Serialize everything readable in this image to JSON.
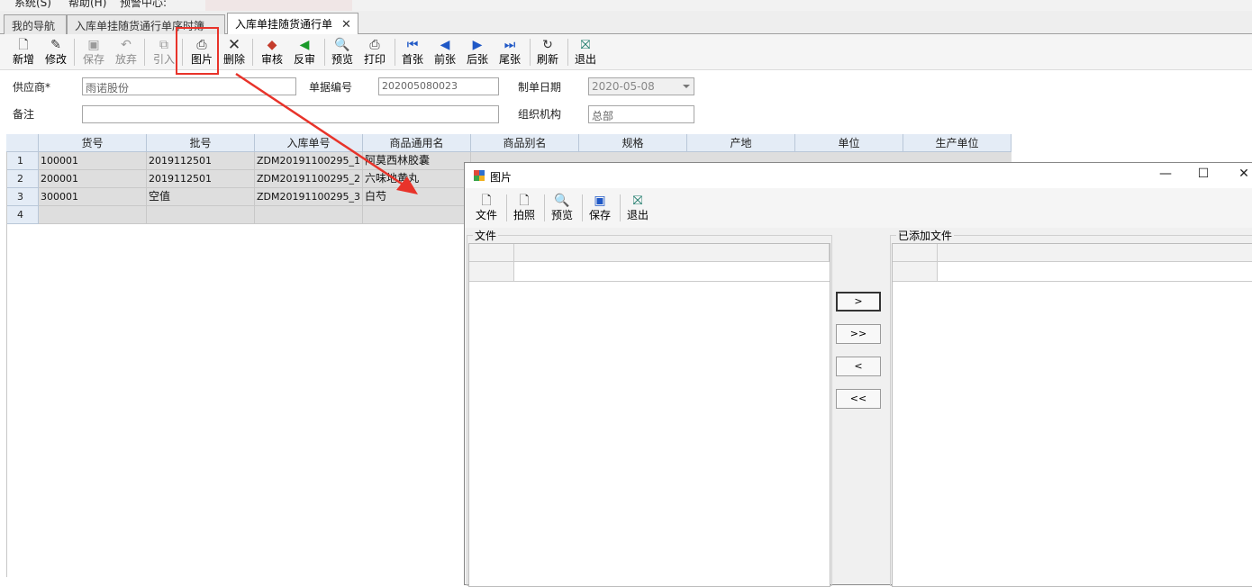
{
  "menubar": {
    "items": [
      "系统(S)",
      "帮助(H)",
      "预警中心:"
    ]
  },
  "tabs": [
    {
      "label": "我的导航"
    },
    {
      "label": "入库单挂随货通行单序时簿"
    },
    {
      "label": "入库单挂随货通行单",
      "close": "✕"
    }
  ],
  "toolbar": {
    "new": "新增",
    "edit": "修改",
    "save": "保存",
    "discard": "放弃",
    "import": "引入",
    "image": "图片",
    "delete": "删除",
    "audit": "审核",
    "unaudit": "反审",
    "preview": "预览",
    "print": "打印",
    "first": "首张",
    "prev": "前张",
    "next": "后张",
    "last": "尾张",
    "refresh": "刷新",
    "exit": "退出"
  },
  "form": {
    "supplier_label": "供应商*",
    "supplier_value": "雨诺股份",
    "docno_label": "单据编号",
    "docno_value": "202005080023",
    "date_label": "制单日期",
    "date_value": "2020-05-08",
    "remark_label": "备注",
    "remark_value": "",
    "org_label": "组织机构",
    "org_value": "总部"
  },
  "grid": {
    "columns": [
      "货号",
      "批号",
      "入库单号",
      "商品通用名",
      "商品别名",
      "规格",
      "产地",
      "单位",
      "生产单位"
    ],
    "rows": [
      {
        "num": "1",
        "cells": [
          "100001",
          "2019112501",
          "ZDM20191100295_1",
          "阿莫西林胶囊"
        ]
      },
      {
        "num": "2",
        "cells": [
          "200001",
          "2019112501",
          "ZDM20191100295_2",
          "六味地黄丸"
        ]
      },
      {
        "num": "3",
        "cells": [
          "300001",
          "空值",
          "ZDM20191100295_3",
          "白芍"
        ]
      },
      {
        "num": "4",
        "cells": [
          "",
          "",
          "",
          ""
        ]
      }
    ]
  },
  "dialog": {
    "title": "图片",
    "window_buttons": {
      "minimize": "—",
      "maximize": "☐",
      "close": "✕"
    },
    "toolbar": {
      "file": "文件",
      "photo": "拍照",
      "preview": "预览",
      "save": "保存",
      "exit": "退出"
    },
    "left_group": "文件",
    "right_group": "已添加文件",
    "buttons": {
      "add_one": ">",
      "add_all": ">>",
      "remove_one": "<",
      "remove_all": "<<"
    }
  },
  "colors": {
    "annotation": "#e8332a",
    "grid_header": "#e4ecf6"
  }
}
